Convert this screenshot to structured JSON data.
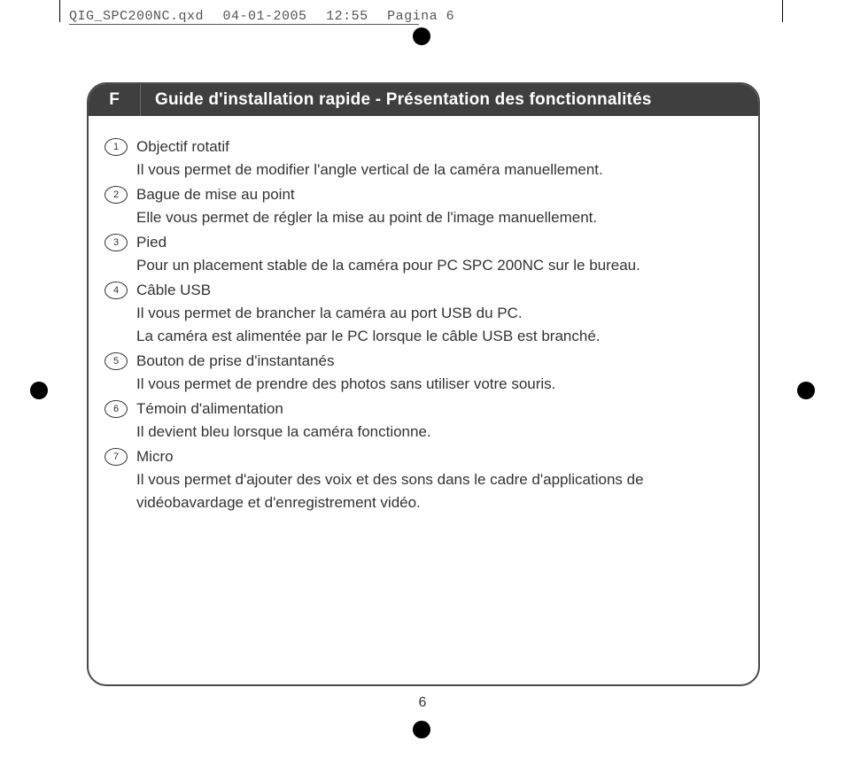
{
  "meta": {
    "filename": "QIG_SPC200NC.qxd",
    "date": "04-01-2005",
    "time": "12:55",
    "pagina": "Pagina 6"
  },
  "header": {
    "lang": "F",
    "title": "Guide d'installation rapide - Présentation des fonctionnalités"
  },
  "items": [
    {
      "n": "1",
      "title": "Objectif rotatif",
      "desc": "Il vous permet de modifier l'angle vertical de la caméra manuellement."
    },
    {
      "n": "2",
      "title": "Bague de mise au point",
      "desc": "Elle vous permet de régler la mise au point de l'image manuellement."
    },
    {
      "n": "3",
      "title": "Pied",
      "desc": "Pour un placement stable de la caméra pour PC SPC 200NC sur le bureau."
    },
    {
      "n": "4",
      "title": "Câble USB",
      "desc": "Il vous permet de brancher la caméra au port USB du PC.\nLa caméra est alimentée par le PC lorsque le câble USB est branché."
    },
    {
      "n": "5",
      "title": "Bouton de prise d'instantanés",
      "desc": "Il vous permet de prendre des photos sans utiliser votre souris."
    },
    {
      "n": "6",
      "title": "Témoin d'alimentation",
      "desc": "Il devient bleu lorsque la caméra fonctionne."
    },
    {
      "n": "7",
      "title": "Micro",
      "desc": "Il vous permet d'ajouter des voix et des sons dans le cadre d'applications de vidéobavardage et d'enregistrement vidéo."
    }
  ],
  "page_number": "6"
}
